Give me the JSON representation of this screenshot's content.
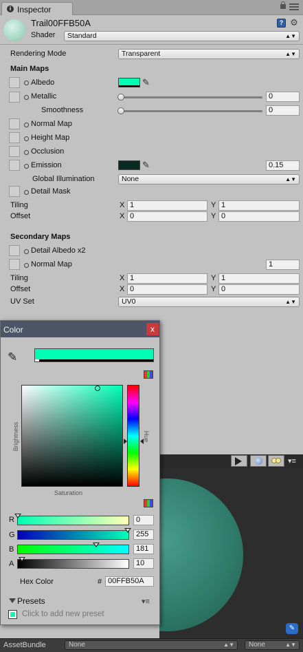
{
  "inspector": {
    "tab_title": "Inspector",
    "material_name": "Trail00FFB50A",
    "shader_label": "Shader",
    "shader_value": "Standard"
  },
  "properties": {
    "rendering_mode_label": "Rendering Mode",
    "rendering_mode_value": "Transparent",
    "main_maps_header": "Main Maps",
    "albedo_label": "Albedo",
    "albedo_color": "#00FFB5",
    "metallic_label": "Metallic",
    "metallic_value": "0",
    "smoothness_label": "Smoothness",
    "smoothness_value": "0",
    "normal_map_label": "Normal Map",
    "height_map_label": "Height Map",
    "occlusion_label": "Occlusion",
    "emission_label": "Emission",
    "emission_color": "#0A2A22",
    "emission_value": "0.15",
    "global_illumination_label": "Global Illumination",
    "global_illumination_value": "None",
    "detail_mask_label": "Detail Mask",
    "tiling_label": "Tiling",
    "offset_label": "Offset",
    "x_label": "X",
    "y_label": "Y",
    "main_tiling_x": "1",
    "main_tiling_y": "1",
    "main_offset_x": "0",
    "main_offset_y": "0",
    "secondary_maps_header": "Secondary Maps",
    "detail_albedo_label": "Detail Albedo x2",
    "secondary_normal_label": "Normal Map",
    "secondary_normal_value": "1",
    "sec_tiling_x": "1",
    "sec_tiling_y": "1",
    "sec_offset_x": "0",
    "sec_offset_y": "0",
    "uv_set_label": "UV Set",
    "uv_set_value": "UV0"
  },
  "color_window": {
    "title": "Color",
    "close_glyph": "x",
    "current_color": "#00FFB5",
    "brightness_label": "Brightness",
    "hue_label": "Hue",
    "saturation_label": "Saturation",
    "r_label": "R",
    "g_label": "G",
    "b_label": "B",
    "a_label": "A",
    "r_value": "0",
    "g_value": "255",
    "b_value": "181",
    "a_value": "10",
    "hex_label": "Hex Color",
    "hex_prefix": "#",
    "hex_value": "00FFB50A",
    "presets_label": "Presets",
    "add_preset_text": "Click to add new preset"
  },
  "footer": {
    "assetbundle_label": "AssetBundle",
    "bundle_name": "None",
    "bundle_variant": "None"
  }
}
